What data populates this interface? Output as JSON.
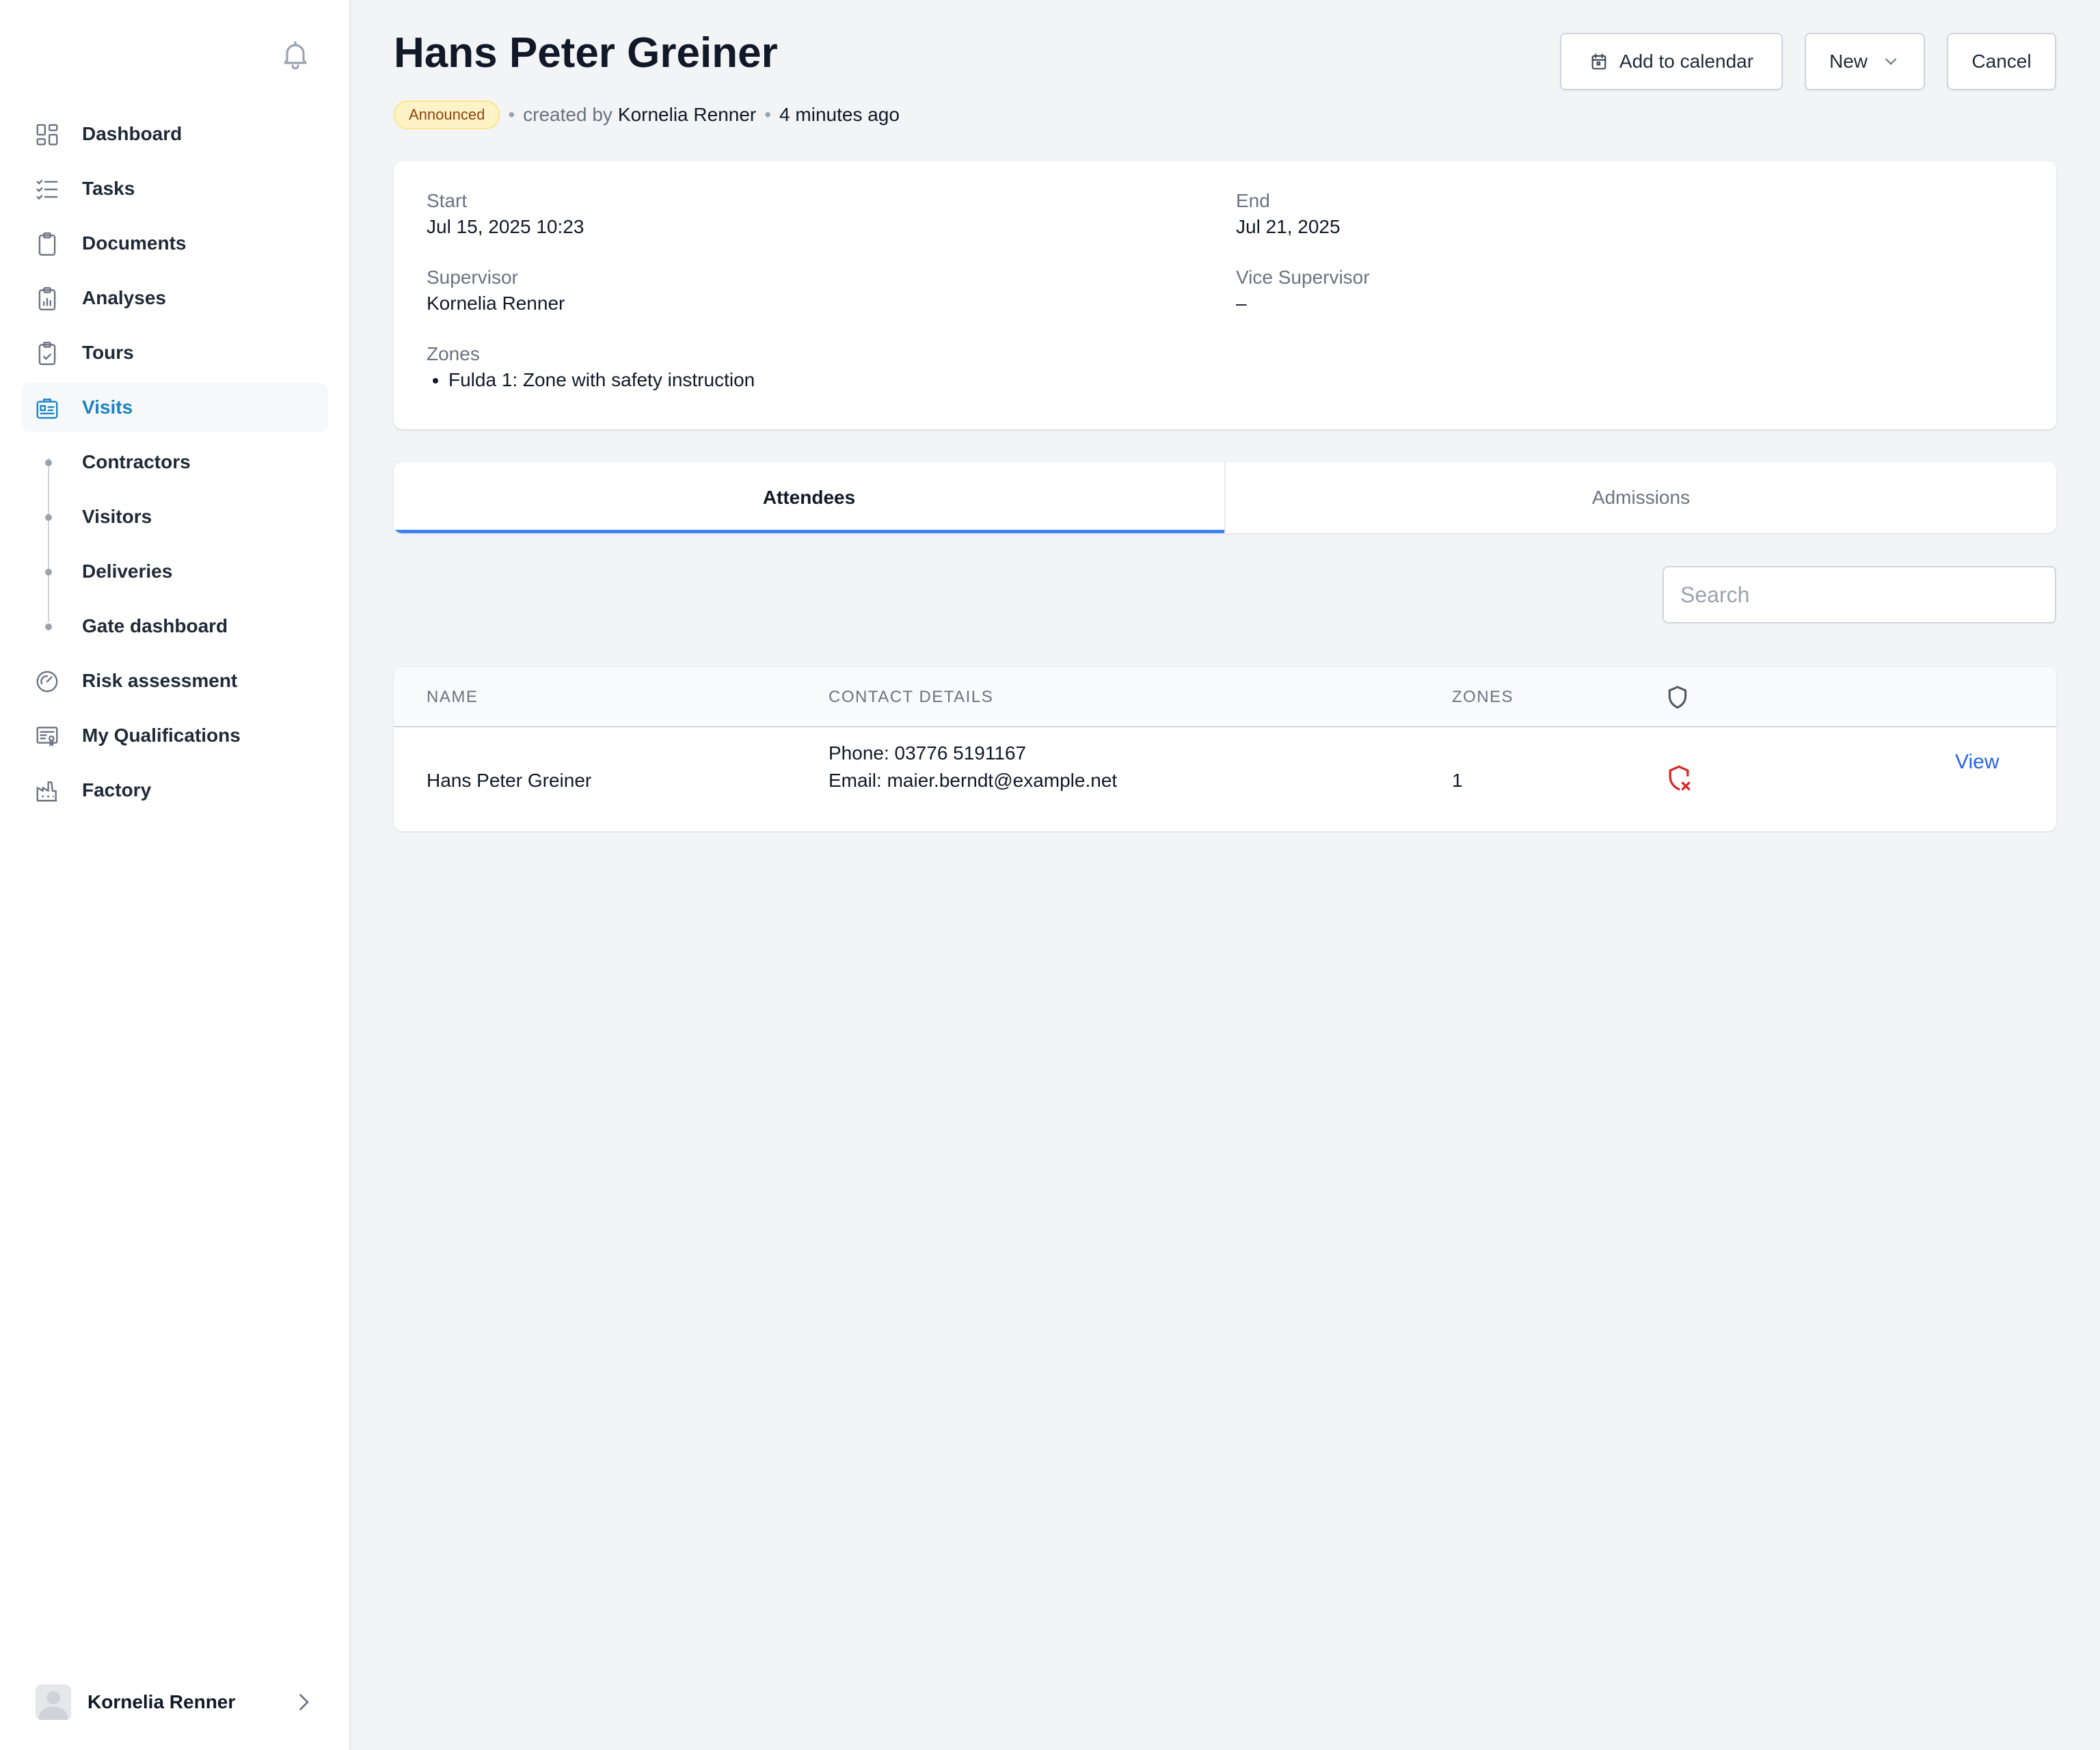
{
  "sidebar": {
    "items": [
      {
        "label": "Dashboard",
        "icon": "dashboard-icon"
      },
      {
        "label": "Tasks",
        "icon": "tasks-icon"
      },
      {
        "label": "Documents",
        "icon": "clipboard-icon"
      },
      {
        "label": "Analyses",
        "icon": "chart-clipboard-icon"
      },
      {
        "label": "Tours",
        "icon": "check-clipboard-icon"
      },
      {
        "label": "Visits",
        "icon": "id-badge-icon"
      }
    ],
    "subitems": [
      {
        "label": "Contractors"
      },
      {
        "label": "Visitors"
      },
      {
        "label": "Deliveries"
      },
      {
        "label": "Gate dashboard"
      }
    ],
    "items_after": [
      {
        "label": "Risk assessment",
        "icon": "gauge-icon"
      },
      {
        "label": "My Qualifications",
        "icon": "certificate-icon"
      },
      {
        "label": "Factory",
        "icon": "factory-icon"
      }
    ],
    "user": {
      "name": "Kornelia Renner"
    }
  },
  "header": {
    "title": "Hans Peter Greiner",
    "status": "Announced",
    "created_by_prefix": "created by",
    "created_by": "Kornelia Renner",
    "time_ago": "4 minutes ago",
    "buttons": {
      "calendar": "Add to calendar",
      "new": "New",
      "cancel": "Cancel"
    }
  },
  "details": {
    "start_label": "Start",
    "start_value": "Jul 15, 2025 10:23",
    "end_label": "End",
    "end_value": "Jul 21, 2025",
    "supervisor_label": "Supervisor",
    "supervisor_value": "Kornelia Renner",
    "vice_label": "Vice Supervisor",
    "vice_value": "–",
    "zones_label": "Zones",
    "zones": [
      "Fulda 1: Zone with safety instruction"
    ]
  },
  "tabs": [
    {
      "label": "Attendees",
      "active": true
    },
    {
      "label": "Admissions",
      "active": false
    }
  ],
  "search": {
    "placeholder": "Search",
    "value": ""
  },
  "table": {
    "headers": {
      "name": "NAME",
      "contact": "CONTACT DETAILS",
      "zones": "ZONES"
    },
    "rows": [
      {
        "name": "Hans Peter Greiner",
        "phone": "Phone: 03776 5191167",
        "email": "Email: maier.berndt@example.net",
        "zones": "1",
        "safety_status": "not-instructed",
        "action": "View"
      }
    ]
  },
  "colors": {
    "accent": "#1783c5",
    "tab_indicator": "#3b82f6",
    "link": "#2563eb",
    "danger": "#dc2626",
    "badge_bg": "#fef3c7"
  }
}
